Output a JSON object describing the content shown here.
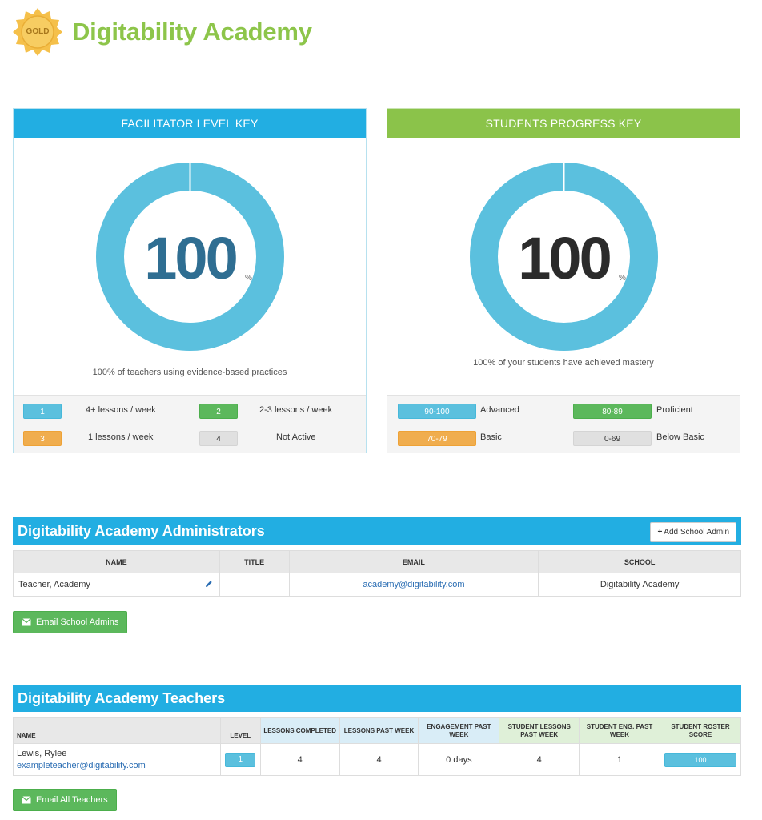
{
  "header": {
    "badge_text": "GOLD",
    "school_name": "Digitability Academy"
  },
  "facilitator_key": {
    "title": "FACILITATOR LEVEL KEY",
    "value": "100",
    "percent_sign": "%",
    "percent_value": 100,
    "caption": "100% of teachers using evidence-based practices",
    "legend": [
      {
        "chip": "1",
        "label": "4+ lessons / week",
        "color": "#5bc0de"
      },
      {
        "chip": "2",
        "label": "2-3 lessons / week",
        "color": "#5cb85c"
      },
      {
        "chip": "3",
        "label": "1 lessons / week",
        "color": "#f0ad4e"
      },
      {
        "chip": "4",
        "label": "Not Active",
        "color": "#e0e0e0"
      }
    ]
  },
  "progress_key": {
    "title": "STUDENTS PROGRESS KEY",
    "value": "100",
    "percent_sign": "%",
    "percent_value": 100,
    "caption": "100% of your students have achieved mastery",
    "legend": [
      {
        "chip": "90-100",
        "label": "Advanced",
        "color": "#5bc0de"
      },
      {
        "chip": "80-89",
        "label": "Proficient",
        "color": "#5cb85c"
      },
      {
        "chip": "70-79",
        "label": "Basic",
        "color": "#f0ad4e"
      },
      {
        "chip": "0-69",
        "label": "Below Basic",
        "color": "#e0e0e0"
      }
    ]
  },
  "admins": {
    "title": "Digitability Academy Administrators",
    "add_button": "Add School Admin",
    "columns": [
      "NAME",
      "TITLE",
      "EMAIL",
      "SCHOOL"
    ],
    "rows": [
      {
        "name": "Teacher, Academy",
        "title": "",
        "email": "academy@digitability.com",
        "school": "Digitability Academy"
      }
    ],
    "email_button": "Email School Admins"
  },
  "teachers": {
    "title": "Digitability Academy Teachers",
    "columns": {
      "name": "NAME",
      "level": "LEVEL",
      "lessons_completed": "LESSONS COMPLETED",
      "lessons_past_week": "LESSONS PAST WEEK",
      "engagement": "ENGAGEMENT PAST WEEK",
      "student_lessons": "STUDENT LESSONS PAST WEEK",
      "student_eng": "STUDENT ENG. PAST WEEK",
      "roster_score": "STUDENT ROSTER SCORE"
    },
    "rows": [
      {
        "name": "Lewis, Rylee",
        "email": "exampleteacher@digitability.com",
        "level": "1",
        "lessons_completed": "4",
        "lessons_past_week": "4",
        "engagement": "0 days",
        "student_lessons": "4",
        "student_eng": "1",
        "roster_score": "100"
      }
    ],
    "email_button": "Email All Teachers"
  },
  "colors": {
    "brand_green": "#8dc54a",
    "brand_blue": "#22aee2",
    "donut": "#5bc0de"
  }
}
